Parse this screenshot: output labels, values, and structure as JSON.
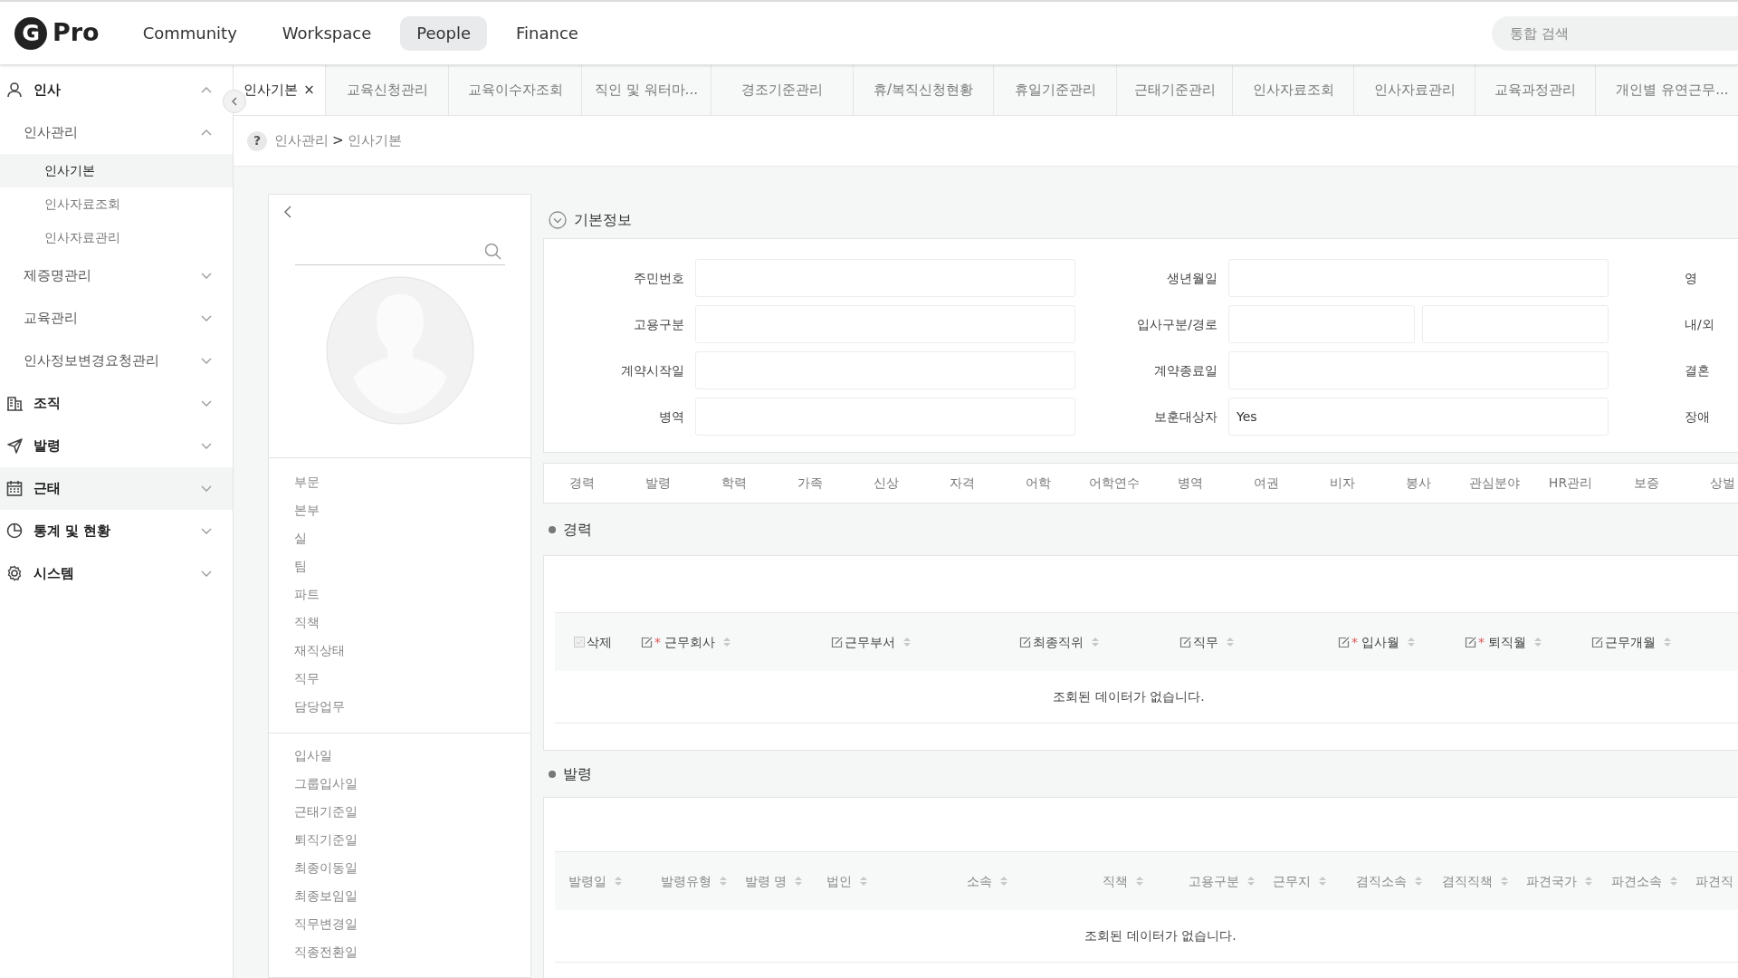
{
  "header": {
    "logo_letter": "G",
    "logo_text": "Pro",
    "nav": [
      {
        "label": "Community",
        "selected": false
      },
      {
        "label": "Workspace",
        "selected": false
      },
      {
        "label": "People",
        "selected": true
      },
      {
        "label": "Finance",
        "selected": false
      }
    ],
    "search": {
      "placeholder": "통합 검색"
    }
  },
  "sidebar": {
    "items": [
      {
        "label": "인사",
        "expanded": true,
        "hovered": false,
        "children": [
          {
            "label": "인사관리",
            "expanded": true,
            "children": [
              {
                "label": "인사기본",
                "selected": true
              },
              {
                "label": "인사자료조회",
                "selected": false
              },
              {
                "label": "인사자료관리",
                "selected": false
              }
            ]
          },
          {
            "label": "제증명관리",
            "expanded": false
          },
          {
            "label": "교육관리",
            "expanded": false
          },
          {
            "label": "인사정보변경요청관리",
            "expanded": false
          }
        ]
      },
      {
        "label": "조직",
        "expanded": false,
        "hovered": false
      },
      {
        "label": "발령",
        "expanded": false,
        "hovered": false
      },
      {
        "label": "근태",
        "expanded": false,
        "hovered": true
      },
      {
        "label": "통계 및 현황",
        "expanded": false,
        "hovered": false
      },
      {
        "label": "시스템",
        "expanded": false,
        "hovered": false
      }
    ]
  },
  "tabs": [
    {
      "label": "인사기본",
      "selected": true,
      "close": "×"
    },
    {
      "label": "교육신청관리",
      "selected": false
    },
    {
      "label": "교육이수자조회",
      "selected": false
    },
    {
      "label": "직인 및 워터마...",
      "selected": false
    },
    {
      "label": "경조기준관리",
      "selected": false
    },
    {
      "label": "휴/복직신청현황",
      "selected": false
    },
    {
      "label": "휴일기준관리",
      "selected": false
    },
    {
      "label": "근태기준관리",
      "selected": false
    },
    {
      "label": "인사자료조회",
      "selected": false
    },
    {
      "label": "인사자료관리",
      "selected": false
    },
    {
      "label": "교육과정관리",
      "selected": false
    },
    {
      "label": "개인별 유연근무...",
      "selected": false
    }
  ],
  "breadcrumb": {
    "help": "?",
    "path": [
      "인사관리",
      "인사기본"
    ],
    "separator": ">"
  },
  "profile_panel": {
    "groups": [
      [
        "부문",
        "본부",
        "실",
        "팀",
        "파트",
        "직책",
        "재직상태",
        "직무",
        "담당업무"
      ],
      [
        "입사일",
        "그룹입사일",
        "근태기준일",
        "퇴직기준일",
        "최종이동일",
        "최종보임일",
        "직무변경일",
        "직종전환일"
      ]
    ]
  },
  "basic_info": {
    "title": "기본정보",
    "rows": [
      [
        {
          "label": "주민번호",
          "kind": "single"
        },
        {
          "label": "생년월일",
          "kind": "single"
        },
        {
          "label": "영",
          "kind": "cut"
        }
      ],
      [
        {
          "label": "고용구분",
          "kind": "single"
        },
        {
          "label": "입사구분/경로",
          "kind": "double"
        },
        {
          "label": "내/외",
          "kind": "cut"
        }
      ],
      [
        {
          "label": "계약시작일",
          "kind": "single"
        },
        {
          "label": "계약종료일",
          "kind": "single"
        },
        {
          "label": "결혼",
          "kind": "cut"
        }
      ],
      [
        {
          "label": "병역",
          "kind": "single"
        },
        {
          "label": "보훈대상자",
          "kind": "single",
          "value": "Yes"
        },
        {
          "label": "장애",
          "kind": "cut"
        }
      ]
    ]
  },
  "section_tabs": [
    "경력",
    "발령",
    "학력",
    "가족",
    "신상",
    "자격",
    "어학",
    "어학연수",
    "병역",
    "여권",
    "비자",
    "봉사",
    "관심분야",
    "HR관리",
    "보증",
    "상벌"
  ],
  "tables": [
    {
      "title": "경력",
      "columns": [
        {
          "label": "삭제",
          "kind": "checkbox"
        },
        {
          "label": "근무회사",
          "kind": "edit",
          "required_mark": "*"
        },
        {
          "label": "근무부서",
          "kind": "edit"
        },
        {
          "label": "최종직위",
          "kind": "edit"
        },
        {
          "label": "직무",
          "kind": "edit"
        },
        {
          "label": "입사월",
          "kind": "edit",
          "required_mark": "*"
        },
        {
          "label": "퇴직월",
          "kind": "edit",
          "required_mark": "*"
        },
        {
          "label": "근무개월",
          "kind": "edit"
        }
      ],
      "empty": "조회된 데이터가 없습니다."
    },
    {
      "title": "발령",
      "columns": [
        {
          "label": "발령일",
          "kind": "plain"
        },
        {
          "label": "발령유형",
          "kind": "plain"
        },
        {
          "label": "발령 명",
          "kind": "plain"
        },
        {
          "label": "법인",
          "kind": "plain"
        },
        {
          "label": "소속",
          "kind": "plain"
        },
        {
          "label": "직책",
          "kind": "plain"
        },
        {
          "label": "고용구분",
          "kind": "plain"
        },
        {
          "label": "근무지",
          "kind": "plain"
        },
        {
          "label": "겸직소속",
          "kind": "plain"
        },
        {
          "label": "겸직직책",
          "kind": "plain"
        },
        {
          "label": "파견국가",
          "kind": "plain"
        },
        {
          "label": "파견소속",
          "kind": "plain"
        },
        {
          "label": "파견직",
          "kind": "cut"
        }
      ],
      "empty": "조회된 데이터가 없습니다."
    }
  ]
}
